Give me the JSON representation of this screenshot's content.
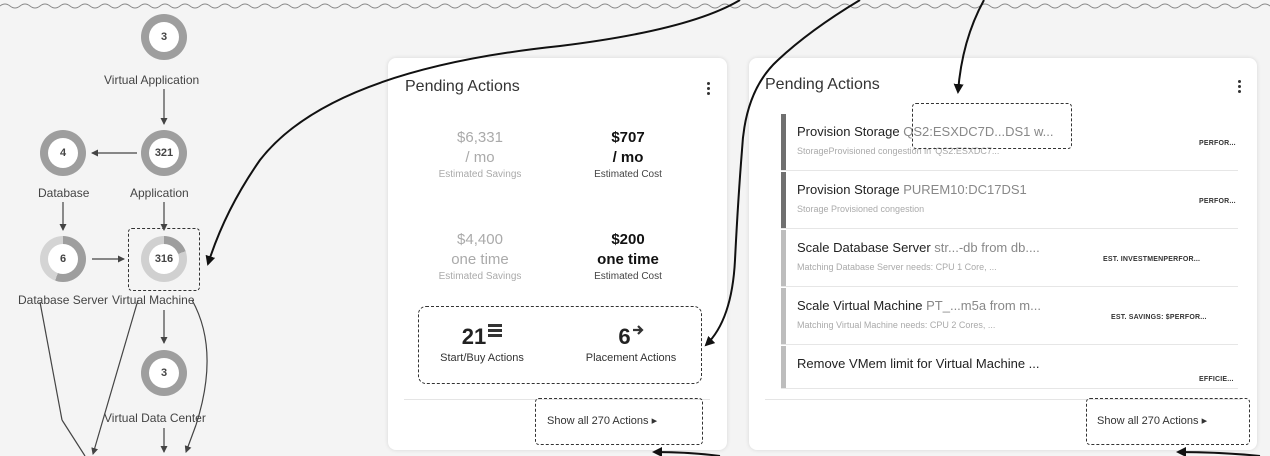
{
  "graph": {
    "nodes": [
      {
        "id": "virtual-application",
        "count": "3",
        "label": "Virtual Application"
      },
      {
        "id": "database",
        "count": "4",
        "label": "Database"
      },
      {
        "id": "application",
        "count": "321",
        "label": "Application"
      },
      {
        "id": "database-server",
        "count": "6",
        "label": "Database Server"
      },
      {
        "id": "virtual-machine",
        "count": "316",
        "label": "Virtual Machine"
      },
      {
        "id": "virtual-data-center",
        "count": "3",
        "label": "Virtual Data Center"
      }
    ]
  },
  "summary_card": {
    "title": "Pending Actions",
    "savings_monthly": {
      "value": "$6,331",
      "unit": "/ mo",
      "caption": "Estimated Savings"
    },
    "cost_monthly": {
      "value": "$707",
      "unit": "/ mo",
      "caption": "Estimated Cost"
    },
    "savings_onetime": {
      "value": "$4,400",
      "unit": "one time",
      "caption": "Estimated Savings"
    },
    "cost_onetime": {
      "value": "$200",
      "unit": "one time",
      "caption": "Estimated Cost"
    },
    "start_buy": {
      "count": "21",
      "caption": "Start/Buy Actions"
    },
    "placement": {
      "count": "6",
      "caption": "Placement Actions"
    },
    "show_all": "Show all 270 Actions ▸"
  },
  "actions_card": {
    "title": "Pending Actions",
    "rows": [
      {
        "title": "Provision Storage ",
        "highlight": "QS2:ESXDC7D...DS1 w...",
        "subtitle": "StorageProvisioned congestion in 'QS2:ESXDC7...",
        "tag": "PERFOR...",
        "bar_color": "#707070"
      },
      {
        "title": "Provision Storage ",
        "highlight": "PUREM10:DC17DS1",
        "subtitle": "Storage Provisioned congestion",
        "tag": "PERFOR...",
        "bar_color": "#707070"
      },
      {
        "title": "Scale Database Server ",
        "highlight": "str...-db from db....",
        "subtitle": "Matching Database Server needs: CPU 1 Core, ...",
        "tag": "EST. INVESTMENPERFOR...",
        "bar_color": "#bdbdbd"
      },
      {
        "title": "Scale Virtual Machine ",
        "highlight": "PT_...m5a from m...",
        "subtitle": "Matching Virtual Machine needs: CPU 2 Cores, ...",
        "tag": "EST. SAVINGS: $PERFOR...",
        "bar_color": "#bdbdbd"
      },
      {
        "title": "Remove VMem limit for Virtual Machine ...",
        "highlight": "",
        "subtitle": "",
        "tag": "EFFICIE...",
        "bar_color": "#bdbdbd"
      }
    ],
    "show_all": "Show all 270 Actions ▸"
  }
}
